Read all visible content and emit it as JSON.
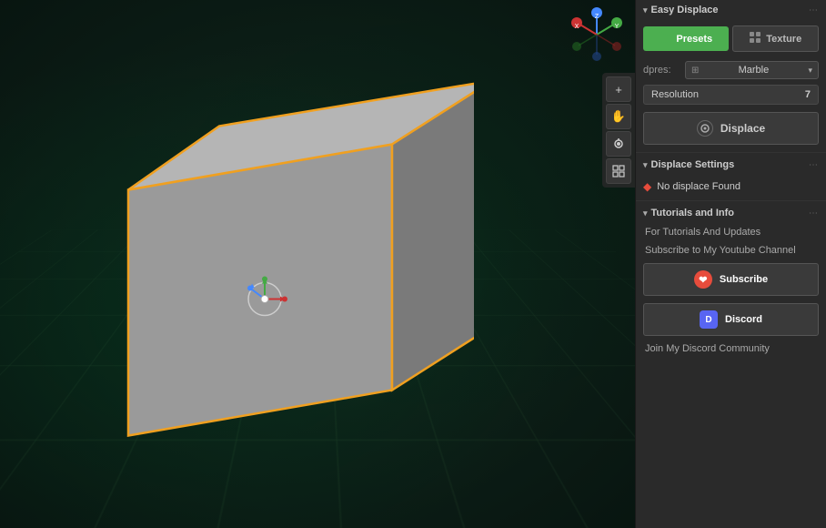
{
  "viewport": {
    "label": "3D Viewport"
  },
  "toolbar": {
    "buttons": [
      {
        "name": "add-button",
        "icon": "+",
        "label": "Add"
      },
      {
        "name": "move-button",
        "icon": "✋",
        "label": "Move"
      },
      {
        "name": "camera-button",
        "icon": "🎥",
        "label": "Camera"
      },
      {
        "name": "grid-button",
        "icon": "⊞",
        "label": "Grid"
      }
    ]
  },
  "panel": {
    "section_easy_displace": {
      "title": "Easy Displace",
      "chevron": "▾"
    },
    "tabs": {
      "presets_label": "Presets",
      "texture_label": "Texture"
    },
    "dropdown": {
      "label": "dpres:",
      "value": "Marble",
      "icon": "⊞"
    },
    "resolution": {
      "label": "Resolution",
      "value": "7"
    },
    "displace_button": {
      "label": "Displace"
    },
    "displace_settings": {
      "title": "Displace Settings",
      "chevron": "▾",
      "no_displace_text": "No displace Found"
    },
    "tutorials": {
      "title": "Tutorials and Info",
      "chevron": "▾",
      "for_tutorials_text": "For Tutorials And Updates",
      "subscribe_text": "Subscribe to My Youtube Channel",
      "subscribe_btn_label": "Subscribe",
      "discord_btn_label": "Discord",
      "join_text": "Join My Discord Community"
    }
  }
}
